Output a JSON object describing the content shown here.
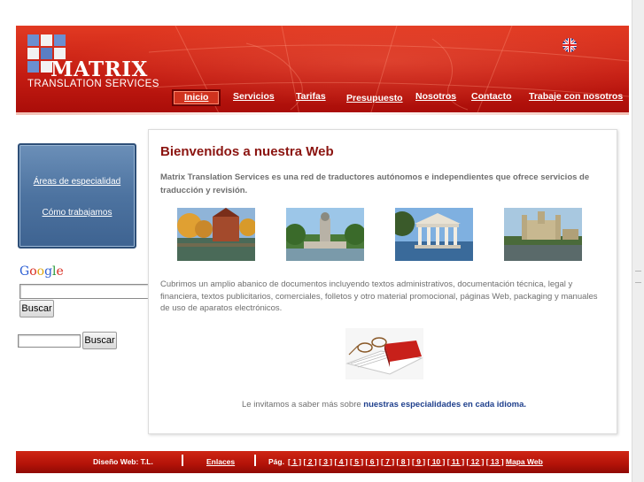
{
  "header": {
    "logo_word": "MATRIX",
    "logo_subtitle": "TRANSLATION SERVICES",
    "language_flag": "uk-flag-icon",
    "nav": [
      {
        "label": "Inicio",
        "active": true
      },
      {
        "label": "Servicios"
      },
      {
        "label": "Tarifas"
      },
      {
        "label": "Presupuesto"
      },
      {
        "label": "Nosotros"
      },
      {
        "label": "Contacto"
      },
      {
        "label": "Trabaje con nosotros"
      }
    ]
  },
  "sidebar": {
    "links": [
      "Áreas de especialidad",
      "Cómo trabajamos"
    ],
    "google_search": {
      "logo": "Google",
      "value": "",
      "button": "Buscar"
    },
    "site_search": {
      "value": "",
      "button": "Buscar"
    }
  },
  "content": {
    "title": "Bienvenidos a nuestra Web",
    "intro": "Matrix Translation Services es una red de traductores autónomos e independientes que ofrece servicios de traducción y revisión.",
    "photos": [
      "canal-town-photo",
      "fountain-park-photo",
      "temple-lake-photo",
      "castle-river-photo"
    ],
    "description": "Cubrimos un amplio abanico de documentos incluyendo textos administrativos, documentación técnica, legal y financiera, textos publicitarios, comerciales, folletos y otro material promocional, páginas Web, packaging y manuales de uso de aparatos electrónicos.",
    "invite_text": "Le invitamos a saber más sobre ",
    "invite_link": "nuestras especialidades en cada idioma."
  },
  "footer": {
    "design": "Diseño Web: T.L.",
    "links": "Enlaces",
    "pages_label": "Pág.",
    "pages": [
      "[ 1 ]",
      "[ 2 ]",
      "[ 3 ]",
      "[ 4 ]",
      "[ 5 ]",
      "[ 6 ]",
      "[ 7 ]",
      "[ 8 ]",
      "[ 9 ]",
      "[ 10 ]",
      "[ 11 ]",
      "[ 12 ]",
      "[ 13 ]"
    ],
    "map": "Mapa Web"
  },
  "colors": {
    "header_red": "#c41c12",
    "title_red": "#8b1410",
    "side_blue": "#4d73a0",
    "link_blue": "#1e3f8c"
  }
}
